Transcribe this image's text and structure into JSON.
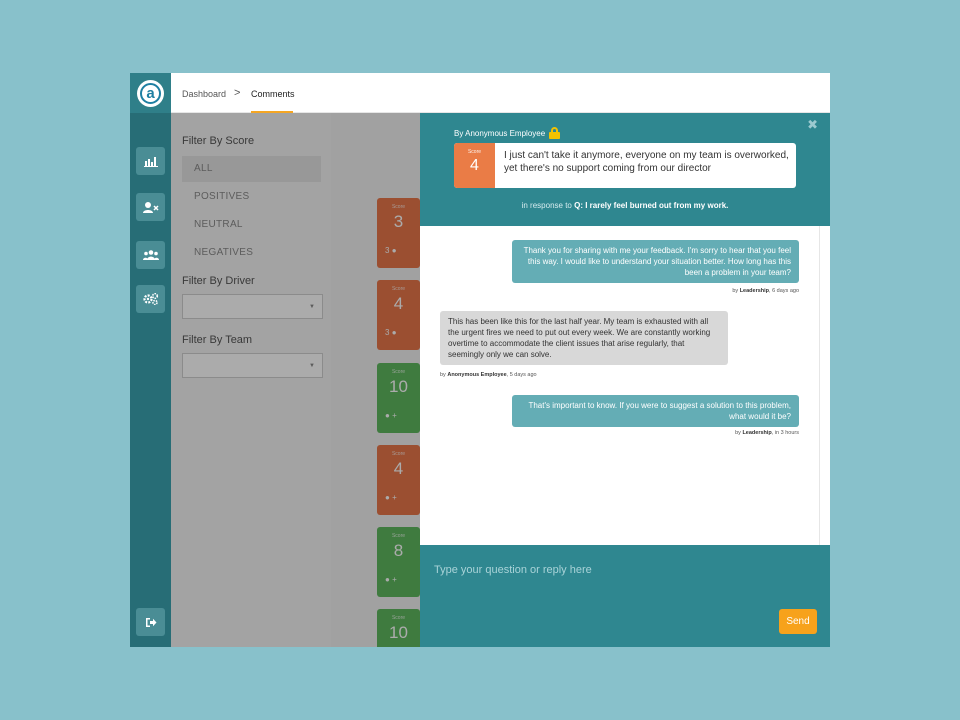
{
  "header": {
    "breadcrumb": [
      "Dashboard",
      "Comments"
    ],
    "separator": ">"
  },
  "rail": {
    "logo_letter": "a",
    "items": [
      {
        "icon": "bar-chart-icon"
      },
      {
        "icon": "remove-user-icon"
      },
      {
        "icon": "team-icon"
      },
      {
        "icon": "settings-icon"
      }
    ],
    "bottom_icon": "logout-icon"
  },
  "filters": {
    "score_title": "Filter By Score",
    "score_options": [
      "ALL",
      "POSITIVES",
      "NEUTRAL",
      "NEGATIVES"
    ],
    "selected_score": "ALL",
    "driver_title": "Filter By Driver",
    "team_title": "Filter By Team"
  },
  "score_cards": [
    {
      "label": "Score",
      "score": "3",
      "meta": "3",
      "color": "#e8764a"
    },
    {
      "label": "Score",
      "score": "4",
      "meta": "3",
      "color": "#e8764a"
    },
    {
      "label": "Score",
      "score": "10",
      "meta": "+",
      "color": "#5fb85f"
    },
    {
      "label": "Score",
      "score": "4",
      "meta": "+",
      "color": "#e8764a"
    },
    {
      "label": "Score",
      "score": "8",
      "meta": "+",
      "color": "#5fb85f"
    },
    {
      "label": "Score",
      "score": "10",
      "meta": "",
      "color": "#5fb85f"
    }
  ],
  "panel": {
    "close": "✖",
    "author": "By Anonymous Employee",
    "score_label": "Score",
    "score": "4",
    "comment": "I just can't take it anymore, everyone on my team is overworked, yet there's no support coming from our director",
    "in_response_prefix": "in response to",
    "question": "Q: I rarely feel burned out from my work.",
    "messages": [
      {
        "text": "Thank you for sharing with me your feedback. I'm sorry to hear that you feel this way. I would like to understand your situation better. How long has this been a problem in your team?",
        "by_prefix": "by",
        "author": "Leadership",
        "time": ", 6 days ago"
      },
      {
        "text": "This has been like this for the last half year. My team is exhausted with all the urgent fires we need to put out every week. We are constantly working overtime to accommodate the client issues that arise regularly, that seemingly only we can solve.",
        "by_prefix": "by",
        "author": "Anonymous Employee",
        "time": ", 5 days ago"
      },
      {
        "text": "That's important to know. If you were to suggest a solution to this problem, what would it be?",
        "by_prefix": "by",
        "author": "Leadership",
        "time": ", in 3 hours"
      }
    ],
    "reply_placeholder": "Type your question or reply here",
    "send_label": "Send"
  },
  "colors": {
    "rail": "#276d76",
    "panel_teal": "#2f8790",
    "accent": "#f5a623",
    "negative": "#ea7c46",
    "positive": "#5fb85f"
  }
}
